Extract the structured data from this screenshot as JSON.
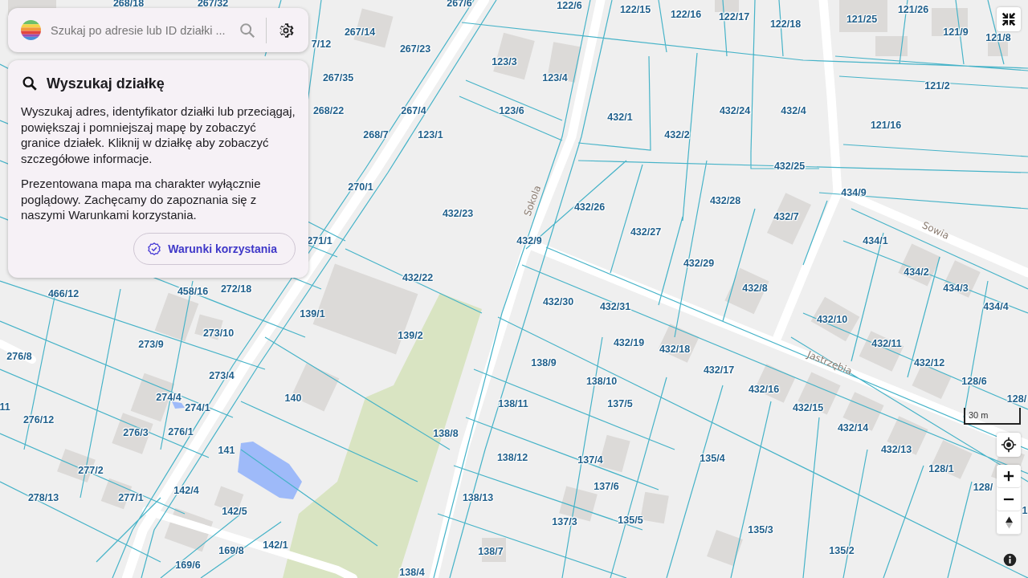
{
  "search": {
    "placeholder": "Szukaj po adresie lub ID działki ..."
  },
  "info_panel": {
    "title": "Wyszukaj działkę",
    "paragraphs": [
      "Wyszukaj adres, identyfikator działki lub przeciągaj, powiększaj i pomniejszaj mapę by zobaczyć granice działek. Kliknij w działkę aby zobaczyć szczegółowe informacje.",
      "Prezentowana mapa ma charakter wyłącznie poglądowy. Zachęcamy do zapoznania się z naszymi Warunkami korzystania."
    ],
    "button": "Warunki korzystania"
  },
  "map": {
    "parcel_labels": [
      "268/18",
      "267/32",
      "267/6",
      "122/6",
      "122/15",
      "121/26",
      "122/16",
      "122/17",
      "121/25",
      "122/18",
      "267/14",
      "121/9",
      "121/8",
      "7/12",
      "267/23",
      "123/3",
      "267/35",
      "123/4",
      "121/2",
      "268/22",
      "267/4",
      "123/6",
      "432/24",
      "432/4",
      "432/1",
      "121/16",
      "268/7",
      "123/1",
      "432/2",
      "432/25",
      "270/1",
      "434/9",
      "432/28",
      "432/26",
      "432/23",
      "432/7",
      "432/27",
      "271/1",
      "432/9",
      "434/1",
      "432/29",
      "434/2",
      "432/22",
      "466/12",
      "458/16",
      "272/18",
      "432/8",
      "434/3",
      "432/30",
      "432/31",
      "434/4",
      "139/1",
      "432/10",
      "273/10",
      "139/2",
      "273/9",
      "432/19",
      "432/18",
      "432/11",
      "276/8",
      "138/9",
      "432/12",
      "432/17",
      "273/4",
      "138/10",
      "128/6",
      "432/16",
      "274/4",
      "140",
      "128/",
      "11",
      "274/1",
      "138/11",
      "137/5",
      "432/15",
      "276/12",
      "432/14",
      "276/3",
      "276/1",
      "138/8",
      "141",
      "432/13",
      "138/12",
      "137/4",
      "135/4",
      "277/2",
      "128/1",
      "137/6",
      "128/",
      "142/4",
      "278/13",
      "277/1",
      "138/13",
      "142/5",
      "1",
      "137/3",
      "135/5",
      "135/3",
      "142/1",
      "169/8",
      "138/7",
      "135/2",
      "169/6",
      "138/4"
    ],
    "street_names": [
      "Sokola",
      "Sowia",
      "Jastrzębia"
    ],
    "scale": "30 m"
  }
}
